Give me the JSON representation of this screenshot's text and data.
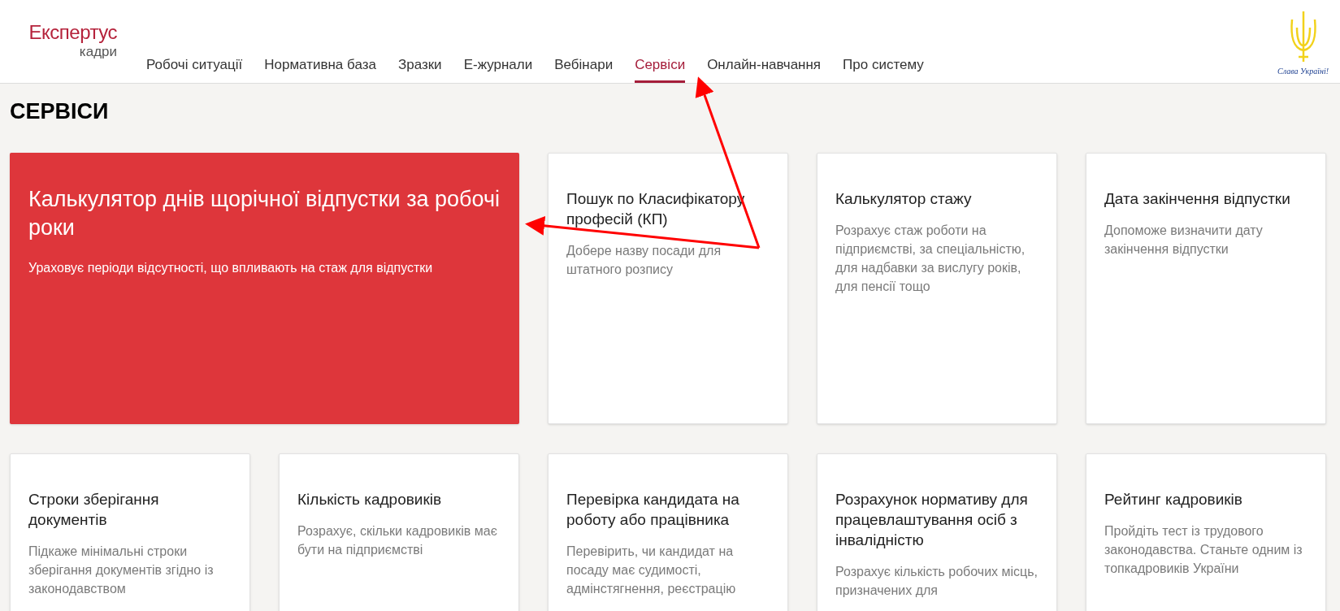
{
  "logo": {
    "name": "Експертус",
    "sub": "кадри"
  },
  "nav": [
    {
      "label": "Робочі ситуації",
      "selected": false
    },
    {
      "label": "Нормативна база",
      "selected": false
    },
    {
      "label": "Зразки",
      "selected": false
    },
    {
      "label": "Е-журнали",
      "selected": false
    },
    {
      "label": "Вебінари",
      "selected": false
    },
    {
      "label": "Сервіси",
      "selected": true
    },
    {
      "label": "Онлайн-навчання",
      "selected": false
    },
    {
      "label": "Про систему",
      "selected": false
    }
  ],
  "emblem_caption": "Слава Україні!",
  "page_title": "СЕРВІСИ",
  "cards": [
    {
      "kind": "featured",
      "title": "Калькулятор днів щорічної відпустки за робочі роки",
      "description": "Ураховує періоди відсутності, що впливають на стаж для відпустки"
    },
    {
      "kind": "regular",
      "title": "Пошук по Класифікатору професій (КП)",
      "description": "Добере назву посади для штатного розпису"
    },
    {
      "kind": "regular",
      "title": "Калькулятор стажу",
      "description": "Розрахує стаж роботи на підприємстві, за спеціальністю, для надбавки за вислугу років, для пенсії тощо"
    },
    {
      "kind": "regular",
      "title": "Дата закінчення відпустки",
      "description": "Допоможе визначити дату закінчення відпустки"
    },
    {
      "kind": "regular",
      "title": "Строки зберігання документів",
      "description": "Підкаже мінімальні строки зберігання документів згідно із законодавством"
    },
    {
      "kind": "regular",
      "title": "Кількість кадровиків",
      "description": "Розрахує, скільки кадровиків має бути на підприємстві"
    },
    {
      "kind": "regular",
      "title": "Перевірка кандидата на роботу або працівника",
      "description": "Перевірить, чи кандидат на посаду має судимості, адмінстягнення, реєстрацію"
    },
    {
      "kind": "regular",
      "title": "Розрахунок нормативу для працевлаштування осіб з інвалідністю",
      "description": "Розрахує кількість робочих місць, призначених для"
    },
    {
      "kind": "regular",
      "title": "Рейтинг кадровиків",
      "description": "Пройдіть тест із трудового законодавства. Станьте одним із топкадровиків України"
    }
  ]
}
